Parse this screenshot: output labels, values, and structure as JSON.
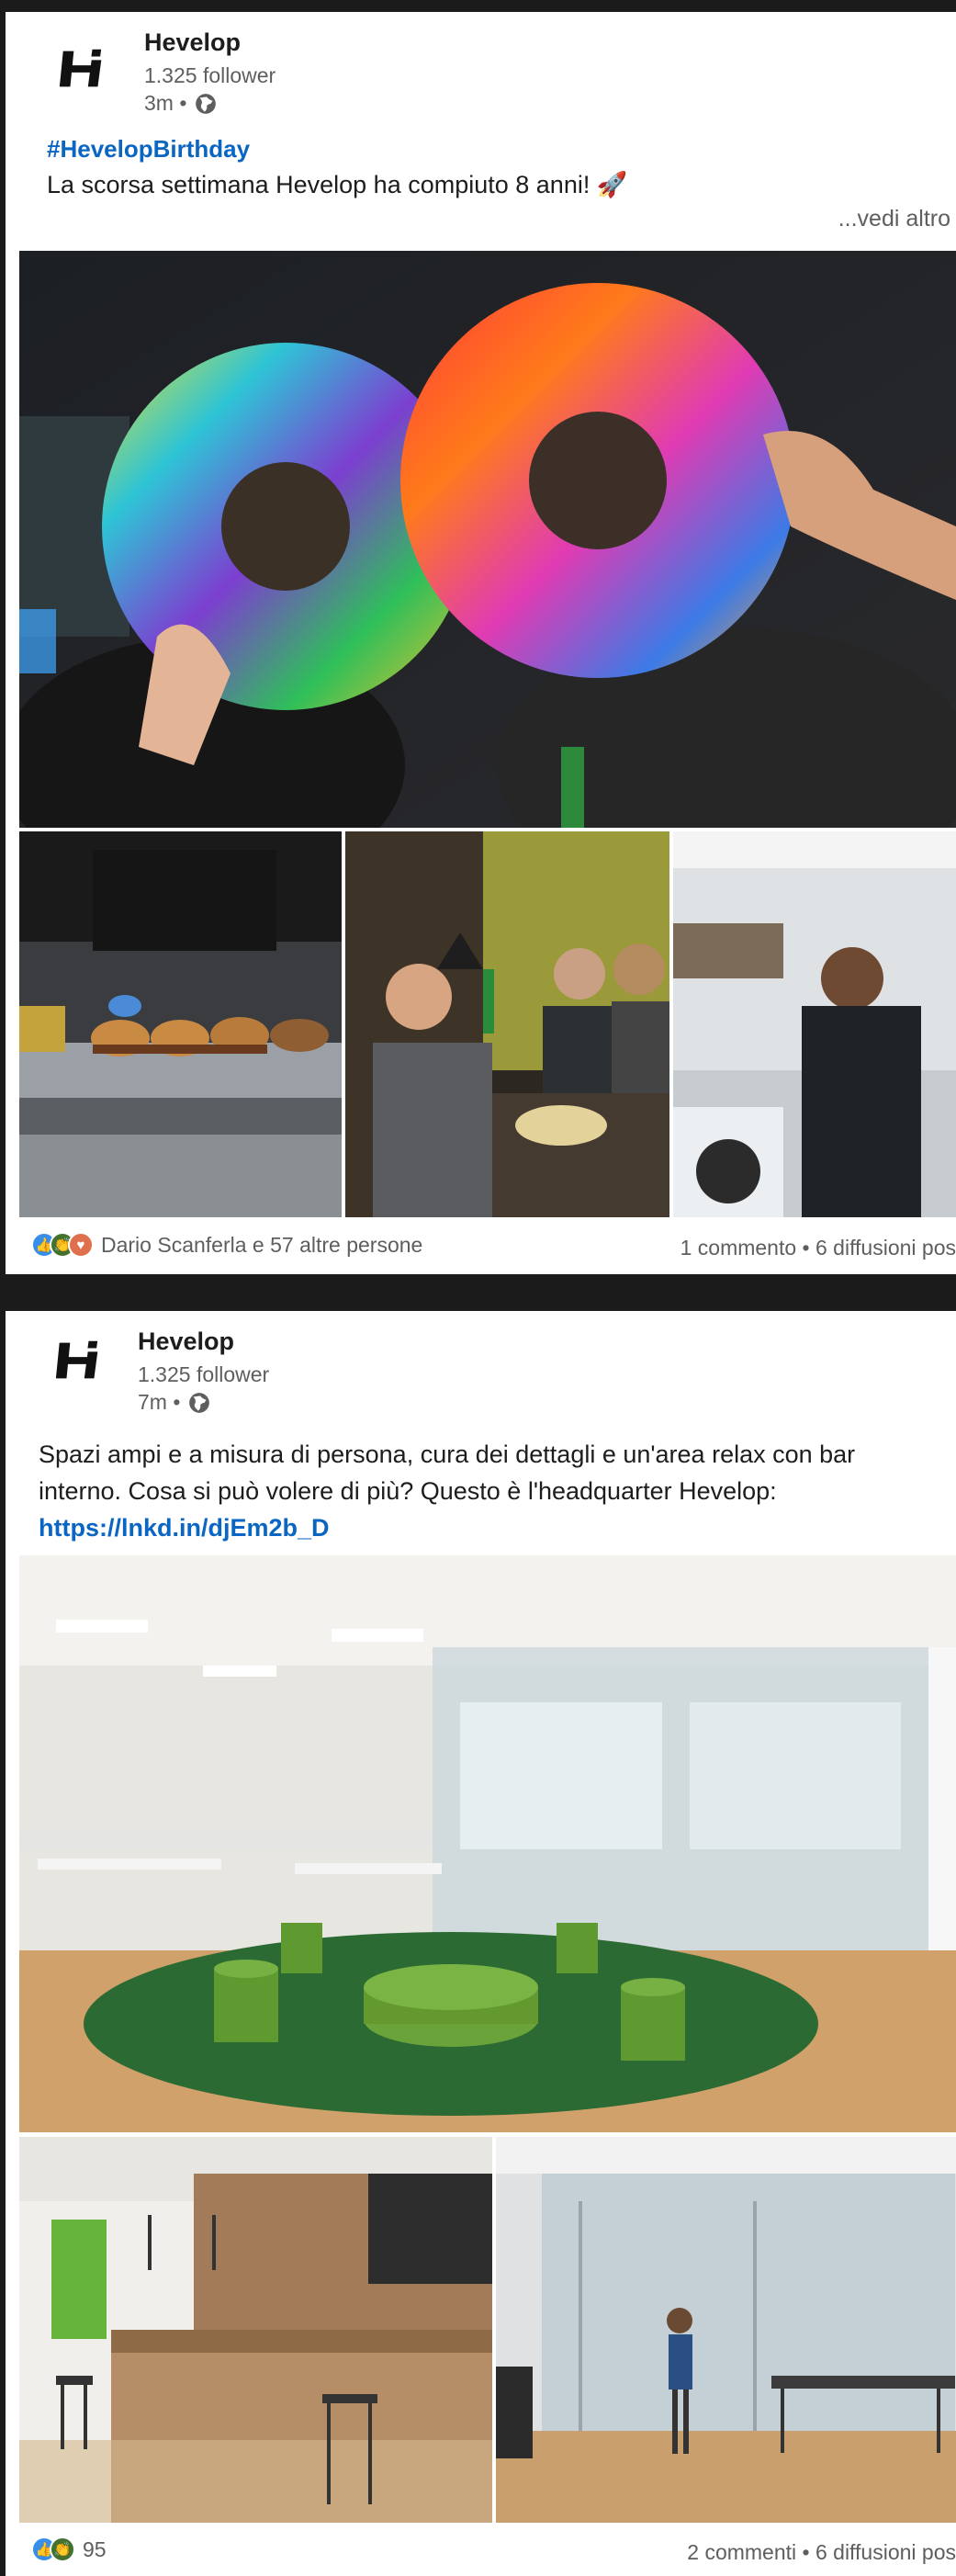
{
  "posts": [
    {
      "author": "Hevelop",
      "followers": "1.325 follower",
      "time": "3m •",
      "hashtag": "#HevelopBirthday",
      "text": "La scorsa settimana Hevelop ha compiuto 8 anni! 🚀",
      "see_more": "...vedi altro",
      "reactions_text": "Dario Scanferla e 57 altre persone",
      "counts_text": "1 commento • 6 diffusioni pos"
    },
    {
      "author": "Hevelop",
      "followers": "1.325 follower",
      "time": "7m •",
      "text_line1": "Spazi ampi e a misura di persona, cura dei dettagli e un'area relax con bar",
      "text_line2": "interno. Cosa si può volere di più? Questo è l'headquarter Hevelop:",
      "link": "https://lnkd.in/djEm2b_D",
      "reactions_count": "95",
      "counts_text": "2 commenti • 6 diffusioni pos"
    }
  ],
  "icons": {
    "logo": "hevelop-logo-icon",
    "globe": "globe-icon",
    "reactions": [
      "like-icon",
      "celebrate-icon",
      "love-icon"
    ]
  },
  "colors": {
    "link": "#0a66c2",
    "background": "#1b1b1b",
    "card": "#ffffff"
  }
}
